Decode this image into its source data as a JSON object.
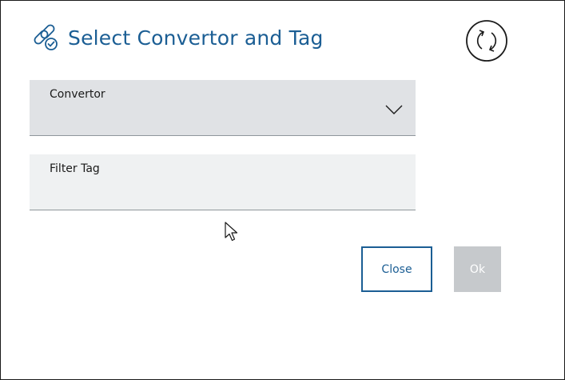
{
  "dialog": {
    "title": "Select Convertor and Tag",
    "title_icon": "link-check-icon",
    "refresh_icon": "refresh-icon"
  },
  "convertor_field": {
    "label": "Convertor",
    "value": "",
    "icon": "chevron-down-icon"
  },
  "filter_tag_field": {
    "label": "Filter Tag",
    "value": ""
  },
  "buttons": {
    "close_label": "Close",
    "ok_label": "Ok"
  },
  "colors": {
    "accent": "#1b5e94",
    "select_bg": "#e0e2e5",
    "input_bg": "#eff1f2",
    "disabled_bg": "#c6c9cc"
  }
}
